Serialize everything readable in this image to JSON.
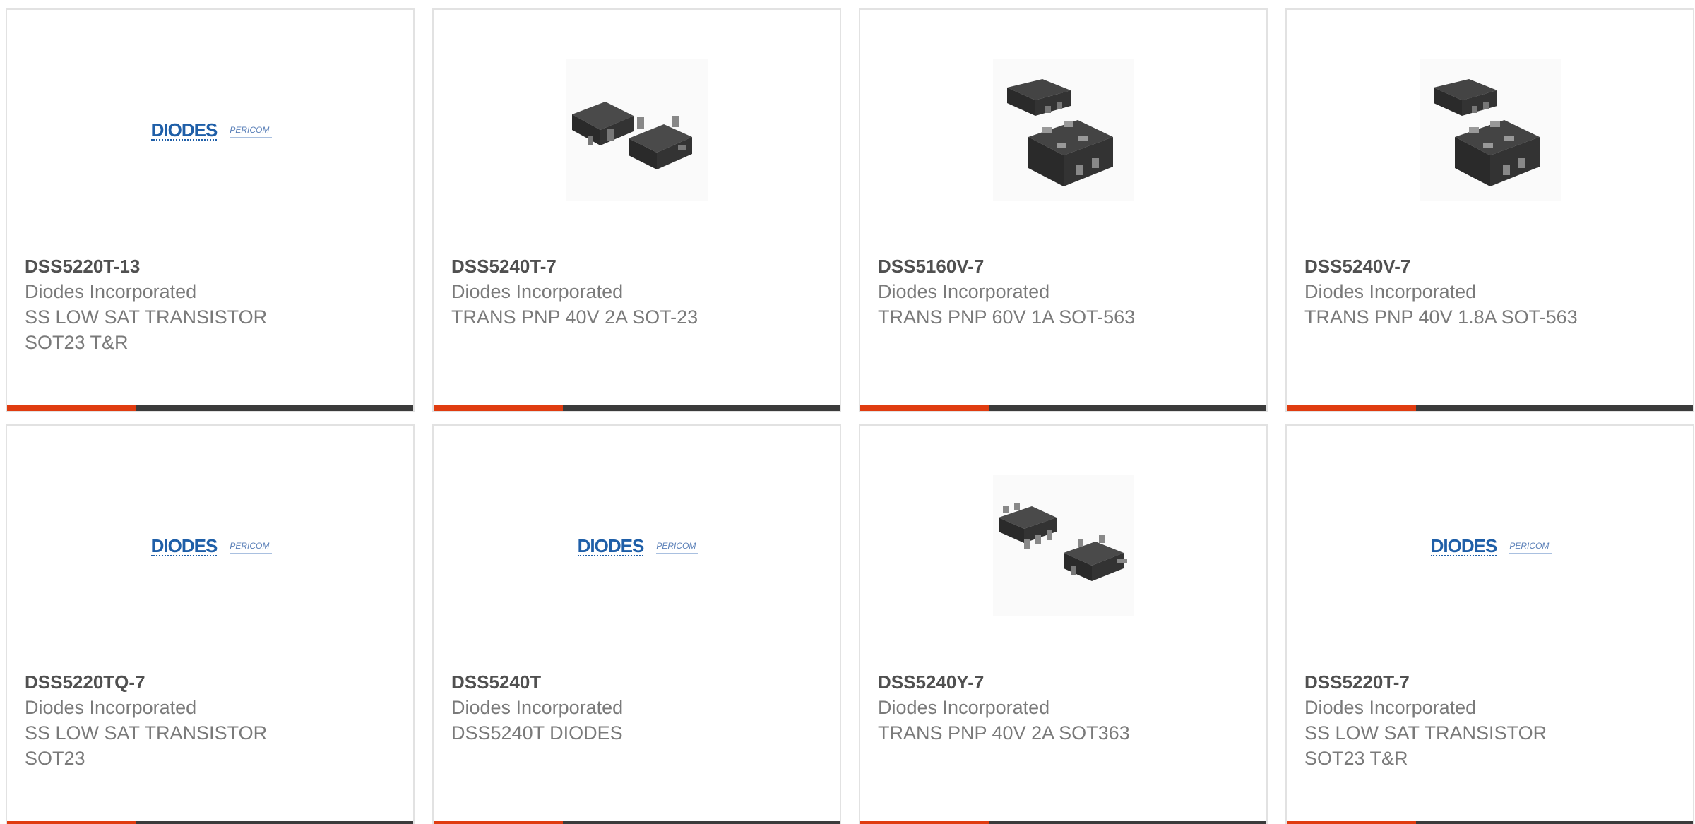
{
  "theme": {
    "accent": "#e03c10",
    "bar": "#3b3b3b",
    "border": "#e2e2e2"
  },
  "products": [
    {
      "part_number": "DSS5220T-13",
      "manufacturer": "Diodes Incorporated",
      "description": "SS LOW SAT TRANSISTOR SOT23 T&R",
      "image": "diodes-logo",
      "logo_brand": "DIODES",
      "logo_sub": "PERICOM"
    },
    {
      "part_number": "DSS5240T-7",
      "manufacturer": "Diodes Incorporated",
      "description": "TRANS PNP 40V 2A SOT-23",
      "image": "sot23-package"
    },
    {
      "part_number": "DSS5160V-7",
      "manufacturer": "Diodes Incorporated",
      "description": "TRANS PNP 60V 1A SOT-563",
      "image": "sot563-package"
    },
    {
      "part_number": "DSS5240V-7",
      "manufacturer": "Diodes Incorporated",
      "description": "TRANS PNP 40V 1.8A SOT-563",
      "image": "sot563-package"
    },
    {
      "part_number": "DSS5220TQ-7",
      "manufacturer": "Diodes Incorporated",
      "description": "SS LOW SAT TRANSISTOR SOT23",
      "image": "diodes-logo",
      "logo_brand": "DIODES",
      "logo_sub": "PERICOM"
    },
    {
      "part_number": "DSS5240T",
      "manufacturer": "Diodes Incorporated",
      "description": "DSS5240T DIODES",
      "image": "diodes-logo",
      "logo_brand": "DIODES",
      "logo_sub": "PERICOM"
    },
    {
      "part_number": "DSS5240Y-7",
      "manufacturer": "Diodes Incorporated",
      "description": "TRANS PNP 40V 2A SOT363",
      "image": "sot363-package"
    },
    {
      "part_number": "DSS5220T-7",
      "manufacturer": "Diodes Incorporated",
      "description": "SS LOW SAT TRANSISTOR SOT23 T&R",
      "image": "diodes-logo",
      "logo_brand": "DIODES",
      "logo_sub": "PERICOM"
    }
  ]
}
